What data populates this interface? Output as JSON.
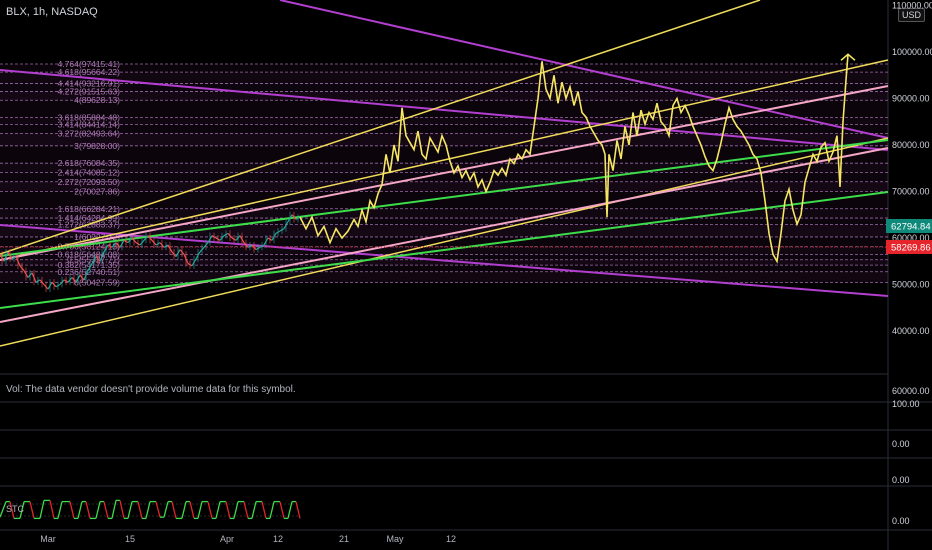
{
  "header": {
    "symbol_title": "BLX, 1h, NASDAQ",
    "currency": "USD",
    "volume_note": "Vol: The data vendor doesn't provide volume data for this symbol.",
    "stc_label": "STC"
  },
  "colors": {
    "background": "#000000",
    "price_path": "#f5e663",
    "yellow_channel": "#f0dc5a",
    "pink_channel": "#f4a6c6",
    "purple_channel": "#b23fd0",
    "green_channel": "#3ddc4a",
    "fib": "#9b6aa8",
    "current_price_badge": "#0f8a7a",
    "red_badge": "#e5242b"
  },
  "chart_data": {
    "type": "line",
    "title": "BLX, 1h, NASDAQ",
    "price_axis": {
      "ticks": [
        "110000.00",
        "100000.00",
        "90000.00",
        "80000.00",
        "70000.00",
        "60000.00",
        "50000.00",
        "40000.00"
      ],
      "current_price": "62794.84",
      "marker_price": "58269.86"
    },
    "date_axis": {
      "ticks": [
        "Mar",
        "15",
        "Apr",
        "12",
        "21",
        "May",
        "12"
      ]
    },
    "fib_levels": [
      {
        "ratio": "4.764",
        "price": "97415.41",
        "text": "4.764(97415.41)",
        "value": 97415.41
      },
      {
        "ratio": "4.618",
        "price": "95664.22",
        "text": "4.618(95664.22)",
        "value": 95664.22
      },
      {
        "ratio": "4.414",
        "price": "93216.91",
        "text": "4.414(93216.91)",
        "value": 93216.91
      },
      {
        "ratio": "4.272",
        "price": "91515.63",
        "text": "4.272(91515.63)",
        "value": 91515.63
      },
      {
        "ratio": "4",
        "price": "89628.13",
        "text": "4(89628.13)",
        "value": 89628.13
      },
      {
        "ratio": "3.618",
        "price": "85884.48",
        "text": "3.618(85884.48)",
        "value": 85884.48
      },
      {
        "ratio": "3.414",
        "price": "84414.14",
        "text": "3.414(84414.14)",
        "value": 84414.14
      },
      {
        "ratio": "3.272",
        "price": "82493.64",
        "text": "3.272(82493.64)",
        "value": 82493.64
      },
      {
        "ratio": "3",
        "price": "79828.00",
        "text": "3(79828.00)",
        "value": 79828.0
      },
      {
        "ratio": "2.618",
        "price": "76084.35",
        "text": "2.618(76084.35)",
        "value": 76084.35
      },
      {
        "ratio": "2.414",
        "price": "74085.12",
        "text": "2.414(74085.12)",
        "value": 74085.12
      },
      {
        "ratio": "2.272",
        "price": "72093.50",
        "text": "2.272(72093.50)",
        "value": 72093.5
      },
      {
        "ratio": "2",
        "price": "70027.86",
        "text": "2(70027.86)",
        "value": 70027.86
      },
      {
        "ratio": "1.618",
        "price": "66284.21",
        "text": "1.618(66284.21)",
        "value": 66284.21
      },
      {
        "ratio": "1.414",
        "price": "64284.99",
        "text": "1.414(64284.99)",
        "value": 64284.99
      },
      {
        "ratio": "1.272",
        "price": "62883.37",
        "text": "1.272(62883.37)",
        "value": 62883.37
      },
      {
        "ratio": "1",
        "price": "60227.72",
        "text": "1(60227.72)",
        "value": 60227.72
      },
      {
        "ratio": "0.786",
        "price": "58124.13",
        "text": "0.786(58124.13)",
        "value": 58124.13
      },
      {
        "ratio": "0.618",
        "price": "56484.08",
        "text": "0.618(56484.08)",
        "value": 56484.08
      },
      {
        "ratio": "0.5",
        "price": "55327.71",
        "text": "0.5(55327.71)",
        "value": 55327.71
      },
      {
        "ratio": "0.382",
        "price": "54171.35",
        "text": "0.382(54171.35)",
        "value": 54171.35
      },
      {
        "ratio": "0.236",
        "price": "52740.51",
        "text": "0.236(52740.51)",
        "value": 52740.51
      },
      {
        "ratio": "0",
        "price": "50427.59",
        "text": "0(50427.59)",
        "value": 50427.59
      }
    ],
    "price_history": [
      [
        0,
        56500
      ],
      [
        4,
        55000
      ],
      [
        8,
        57000
      ],
      [
        12,
        55500
      ],
      [
        16,
        56000
      ],
      [
        20,
        54000
      ],
      [
        24,
        53000
      ],
      [
        28,
        51500
      ],
      [
        32,
        52500
      ],
      [
        36,
        50500
      ],
      [
        40,
        51000
      ],
      [
        44,
        50000
      ],
      [
        48,
        49000
      ],
      [
        52,
        50500
      ],
      [
        56,
        49500
      ],
      [
        60,
        50000
      ],
      [
        64,
        51000
      ],
      [
        68,
        50500
      ],
      [
        72,
        51500
      ],
      [
        76,
        50500
      ],
      [
        80,
        52000
      ],
      [
        84,
        51000
      ],
      [
        88,
        53000
      ],
      [
        92,
        54500
      ],
      [
        96,
        56000
      ],
      [
        100,
        55000
      ],
      [
        104,
        57000
      ],
      [
        108,
        58500
      ],
      [
        112,
        58000
      ],
      [
        116,
        59000
      ],
      [
        120,
        58000
      ],
      [
        124,
        59500
      ],
      [
        128,
        59000
      ],
      [
        132,
        60000
      ],
      [
        136,
        59000
      ],
      [
        140,
        58500
      ],
      [
        144,
        59500
      ],
      [
        148,
        60500
      ],
      [
        152,
        59500
      ],
      [
        156,
        58500
      ],
      [
        160,
        59000
      ],
      [
        164,
        58000
      ],
      [
        168,
        58500
      ],
      [
        172,
        57000
      ],
      [
        176,
        56000
      ],
      [
        180,
        57500
      ],
      [
        184,
        56500
      ],
      [
        188,
        54500
      ],
      [
        192,
        54000
      ],
      [
        196,
        55500
      ],
      [
        200,
        57000
      ],
      [
        204,
        58000
      ],
      [
        208,
        59000
      ],
      [
        212,
        60500
      ],
      [
        216,
        60000
      ],
      [
        220,
        59500
      ],
      [
        224,
        60500
      ],
      [
        228,
        61000
      ],
      [
        232,
        60000
      ],
      [
        236,
        59500
      ],
      [
        240,
        60500
      ],
      [
        244,
        59000
      ],
      [
        248,
        58000
      ],
      [
        252,
        58500
      ],
      [
        256,
        57500
      ],
      [
        260,
        58000
      ],
      [
        264,
        58500
      ],
      [
        268,
        60000
      ],
      [
        272,
        59500
      ],
      [
        276,
        61000
      ],
      [
        280,
        61500
      ],
      [
        284,
        62000
      ],
      [
        288,
        63500
      ],
      [
        292,
        65000
      ],
      [
        296,
        64000
      ],
      [
        300,
        64500
      ]
    ],
    "projection": [
      [
        300,
        64500
      ],
      [
        306,
        62000
      ],
      [
        312,
        64500
      ],
      [
        318,
        60500
      ],
      [
        324,
        62500
      ],
      [
        330,
        59000
      ],
      [
        336,
        62000
      ],
      [
        342,
        60000
      ],
      [
        348,
        61500
      ],
      [
        354,
        64000
      ],
      [
        358,
        62500
      ],
      [
        362,
        66000
      ],
      [
        366,
        63500
      ],
      [
        370,
        68000
      ],
      [
        374,
        66500
      ],
      [
        378,
        69500
      ],
      [
        382,
        71500
      ],
      [
        386,
        78000
      ],
      [
        390,
        74000
      ],
      [
        394,
        80000
      ],
      [
        398,
        76500
      ],
      [
        402,
        88000
      ],
      [
        406,
        82000
      ],
      [
        410,
        80500
      ],
      [
        414,
        79000
      ],
      [
        418,
        83000
      ],
      [
        422,
        78000
      ],
      [
        426,
        77000
      ],
      [
        430,
        81500
      ],
      [
        434,
        80000
      ],
      [
        438,
        78500
      ],
      [
        442,
        82000
      ],
      [
        446,
        80000
      ],
      [
        450,
        76500
      ],
      [
        454,
        74000
      ],
      [
        458,
        75500
      ],
      [
        462,
        73000
      ],
      [
        466,
        74500
      ],
      [
        470,
        72500
      ],
      [
        474,
        74000
      ],
      [
        478,
        71000
      ],
      [
        482,
        72500
      ],
      [
        486,
        70000
      ],
      [
        490,
        72000
      ],
      [
        494,
        74500
      ],
      [
        498,
        73500
      ],
      [
        502,
        75000
      ],
      [
        506,
        73500
      ],
      [
        510,
        77000
      ],
      [
        514,
        76000
      ],
      [
        518,
        78000
      ],
      [
        522,
        77000
      ],
      [
        526,
        79000
      ],
      [
        530,
        78000
      ],
      [
        534,
        84000
      ],
      [
        538,
        90000
      ],
      [
        542,
        98000
      ],
      [
        546,
        92000
      ],
      [
        550,
        90000
      ],
      [
        554,
        95000
      ],
      [
        558,
        89000
      ],
      [
        562,
        93500
      ],
      [
        566,
        90000
      ],
      [
        570,
        92500
      ],
      [
        574,
        88500
      ],
      [
        578,
        91500
      ],
      [
        582,
        87000
      ],
      [
        586,
        86000
      ],
      [
        590,
        84000
      ],
      [
        594,
        82500
      ],
      [
        598,
        81000
      ],
      [
        602,
        80000
      ],
      [
        605,
        78000
      ],
      [
        607,
        64500
      ],
      [
        609,
        78000
      ],
      [
        613,
        74500
      ],
      [
        617,
        81000
      ],
      [
        621,
        77000
      ],
      [
        625,
        84000
      ],
      [
        629,
        80000
      ],
      [
        633,
        87000
      ],
      [
        637,
        82000
      ],
      [
        641,
        87500
      ],
      [
        645,
        84500
      ],
      [
        649,
        87000
      ],
      [
        653,
        85500
      ],
      [
        657,
        89000
      ],
      [
        661,
        85000
      ],
      [
        665,
        84000
      ],
      [
        669,
        82000
      ],
      [
        673,
        88500
      ],
      [
        677,
        90000
      ],
      [
        681,
        87000
      ],
      [
        685,
        88500
      ],
      [
        689,
        86500
      ],
      [
        693,
        84000
      ],
      [
        697,
        82000
      ],
      [
        701,
        80000
      ],
      [
        705,
        77500
      ],
      [
        709,
        75500
      ],
      [
        713,
        74500
      ],
      [
        717,
        77000
      ],
      [
        721,
        80500
      ],
      [
        725,
        84500
      ],
      [
        729,
        88000
      ],
      [
        733,
        85500
      ],
      [
        737,
        84000
      ],
      [
        741,
        83000
      ],
      [
        745,
        81500
      ],
      [
        749,
        80000
      ],
      [
        753,
        78000
      ],
      [
        757,
        77000
      ],
      [
        761,
        74000
      ],
      [
        765,
        68000
      ],
      [
        769,
        61000
      ],
      [
        773,
        56500
      ],
      [
        777,
        55000
      ],
      [
        781,
        61000
      ],
      [
        785,
        68000
      ],
      [
        789,
        70500
      ],
      [
        793,
        66000
      ],
      [
        797,
        63000
      ],
      [
        801,
        65000
      ],
      [
        805,
        72000
      ],
      [
        809,
        75000
      ],
      [
        813,
        78000
      ],
      [
        817,
        76500
      ],
      [
        821,
        79500
      ],
      [
        825,
        80500
      ],
      [
        829,
        76500
      ],
      [
        833,
        78500
      ],
      [
        837,
        82000
      ],
      [
        840,
        71000
      ],
      [
        843,
        85000
      ],
      [
        846,
        94000
      ],
      [
        848,
        99500
      ]
    ],
    "stc_values": [
      [
        0,
        0.2
      ],
      [
        6,
        0.85
      ],
      [
        10,
        0.85
      ],
      [
        14,
        0.15
      ],
      [
        20,
        0.15
      ],
      [
        24,
        0.85
      ],
      [
        30,
        0.85
      ],
      [
        34,
        0.15
      ],
      [
        40,
        0.15
      ],
      [
        44,
        0.9
      ],
      [
        50,
        0.9
      ],
      [
        54,
        0.15
      ],
      [
        58,
        0.15
      ],
      [
        62,
        0.85
      ],
      [
        70,
        0.85
      ],
      [
        74,
        0.15
      ],
      [
        78,
        0.15
      ],
      [
        82,
        0.85
      ],
      [
        86,
        0.85
      ],
      [
        90,
        0.15
      ],
      [
        96,
        0.15
      ],
      [
        100,
        0.85
      ],
      [
        104,
        0.85
      ],
      [
        108,
        0.15
      ],
      [
        112,
        0.15
      ],
      [
        116,
        0.9
      ],
      [
        120,
        0.9
      ],
      [
        124,
        0.15
      ],
      [
        128,
        0.15
      ],
      [
        132,
        0.85
      ],
      [
        138,
        0.85
      ],
      [
        142,
        0.15
      ],
      [
        146,
        0.15
      ],
      [
        150,
        0.85
      ],
      [
        156,
        0.85
      ],
      [
        160,
        0.2
      ],
      [
        164,
        0.2
      ],
      [
        168,
        0.85
      ],
      [
        172,
        0.85
      ],
      [
        176,
        0.15
      ],
      [
        182,
        0.15
      ],
      [
        186,
        0.85
      ],
      [
        190,
        0.85
      ],
      [
        194,
        0.15
      ],
      [
        198,
        0.15
      ],
      [
        202,
        0.85
      ],
      [
        208,
        0.85
      ],
      [
        212,
        0.15
      ],
      [
        216,
        0.15
      ],
      [
        220,
        0.85
      ],
      [
        226,
        0.85
      ],
      [
        230,
        0.15
      ],
      [
        234,
        0.15
      ],
      [
        238,
        0.85
      ],
      [
        244,
        0.85
      ],
      [
        248,
        0.15
      ],
      [
        252,
        0.15
      ],
      [
        256,
        0.85
      ],
      [
        262,
        0.85
      ],
      [
        266,
        0.15
      ],
      [
        270,
        0.15
      ],
      [
        274,
        0.85
      ],
      [
        280,
        0.85
      ],
      [
        284,
        0.15
      ],
      [
        288,
        0.15
      ],
      [
        292,
        0.85
      ],
      [
        296,
        0.85
      ],
      [
        300,
        0.15
      ]
    ]
  }
}
